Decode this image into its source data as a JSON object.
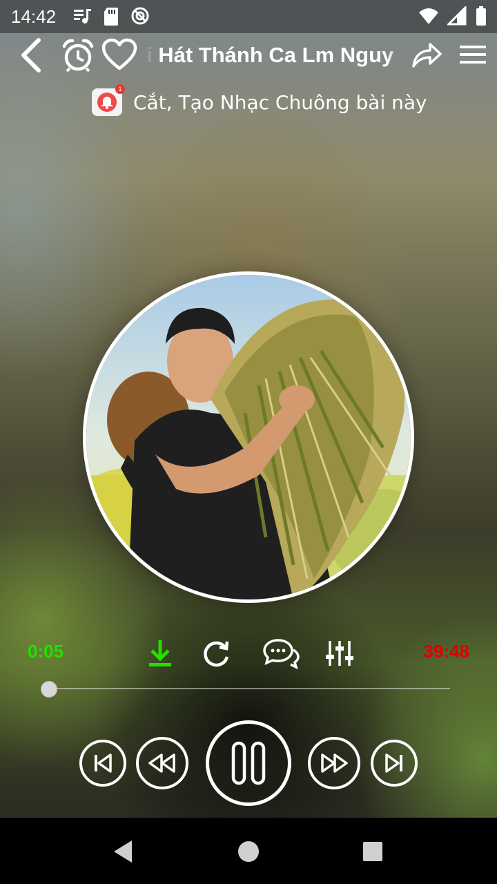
{
  "status_bar": {
    "time": "14:42",
    "left_icons": [
      "music-note-icon",
      "sd-card-icon",
      "sync-icon"
    ],
    "right_icons": [
      "wifi-icon",
      "signal-icon",
      "battery-icon"
    ]
  },
  "header": {
    "back_icon": "chevron-left-icon",
    "alarm_icon": "alarm-clock-icon",
    "favorite_icon": "heart-icon",
    "title": "i Hát Thánh Ca Lm Nguy",
    "share_icon": "share-icon",
    "menu_icon": "hamburger-menu-icon"
  },
  "ringtone": {
    "badge_count": "1",
    "label": "Cắt, Tạo Nhạc Chuông bài này"
  },
  "player": {
    "current_time": "0:05",
    "total_time": "39:48",
    "progress": 0.002,
    "tools": [
      "download-icon",
      "repeat-icon",
      "comment-icon",
      "equalizer-icon"
    ],
    "controls": [
      "skip-previous-icon",
      "rewind-icon",
      "pause-icon",
      "fast-forward-icon",
      "skip-next-icon"
    ]
  },
  "colors": {
    "current_time": "#22e000",
    "total_time": "#e00000",
    "download": "#22e000"
  },
  "navbar": {
    "buttons": [
      "back-triangle-icon",
      "home-circle-icon",
      "recents-square-icon"
    ]
  }
}
